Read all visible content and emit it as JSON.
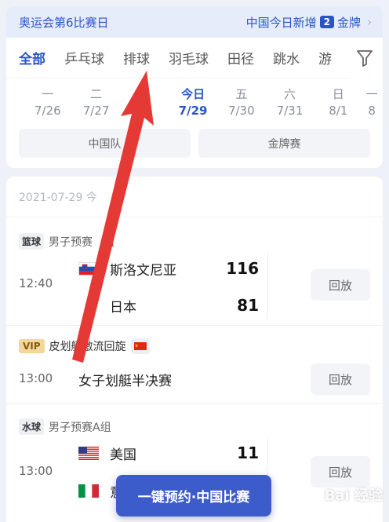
{
  "banner": {
    "left_text": "奥运会第6比赛日",
    "right_prefix": "中国今日新增",
    "right_count": "2",
    "right_suffix": "金牌"
  },
  "sport_tabs": [
    "全部",
    "乒乓球",
    "排球",
    "羽毛球",
    "田径",
    "跳水",
    "游"
  ],
  "dates": [
    {
      "weekday": "一",
      "date": "7/26"
    },
    {
      "weekday": "二",
      "date": "7/27"
    },
    {
      "weekday": "",
      "date": ""
    },
    {
      "weekday": "今日",
      "date": "7/29"
    },
    {
      "weekday": "五",
      "date": "7/30"
    },
    {
      "weekday": "六",
      "date": "7/31"
    },
    {
      "weekday": "日",
      "date": "8/1"
    },
    {
      "weekday": "一",
      "date": "8"
    }
  ],
  "filters": {
    "china_team": "中国队",
    "gold_match": "金牌赛"
  },
  "list": {
    "date_header": "2021-07-29 今",
    "matches": [
      {
        "tag": "篮球",
        "group": "男子预赛",
        "group_tail": "组",
        "time": "12:40",
        "team_a": "斯洛文尼亚",
        "score_a": "116",
        "team_b": "日本",
        "score_b": "81",
        "replay": "回放"
      },
      {
        "vip": "VIP",
        "group": "皮划艇激流回旋",
        "time": "13:00",
        "title": "女子划艇半决赛",
        "replay": "回放"
      },
      {
        "tag": "水球",
        "group": "男子预赛A组",
        "time": "13:00",
        "team_a": "美国",
        "score_a": "11",
        "team_b": "意",
        "replay": "回放"
      }
    ]
  },
  "cta_label": "一键预约·中国比赛",
  "watermark": "Bai 经验",
  "colors": {
    "accent": "#2a55c9",
    "cta": "#3d5ccb",
    "annotation_arrow": "#e53935"
  }
}
